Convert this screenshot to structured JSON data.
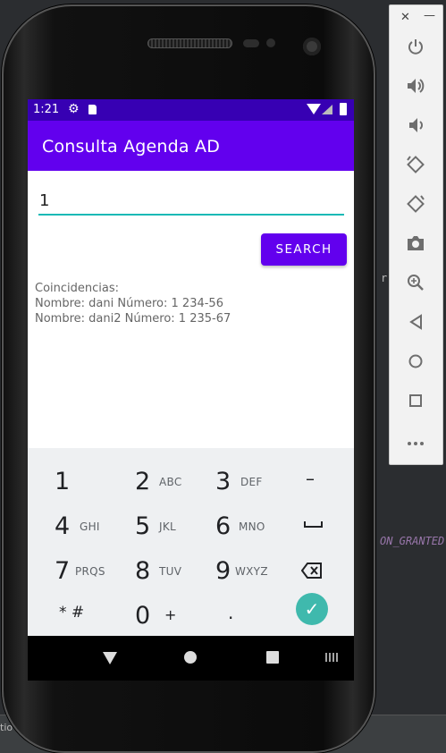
{
  "ide": {
    "code_fragment": "ON_GRANTED",
    "code_char": "r",
    "bottom_fragment": "tio"
  },
  "status_bar": {
    "time": "1:21"
  },
  "app_bar": {
    "title": "Consulta Agenda AD"
  },
  "form": {
    "search_value": "1",
    "search_button": "SEARCH"
  },
  "results": {
    "header": "Coincidencias:",
    "items": [
      "Nombre: dani Número: 1 234-56",
      "Nombre: dani2 Número: 1 235-67"
    ]
  },
  "keypad": {
    "keys": [
      {
        "digit": "1",
        "letters": ""
      },
      {
        "digit": "2",
        "letters": "ABC"
      },
      {
        "digit": "3",
        "letters": "DEF"
      },
      {
        "digit": "4",
        "letters": "GHI"
      },
      {
        "digit": "5",
        "letters": "JKL"
      },
      {
        "digit": "6",
        "letters": "MNO"
      },
      {
        "digit": "7",
        "letters": "PRQS"
      },
      {
        "digit": "8",
        "letters": "TUV"
      },
      {
        "digit": "9",
        "letters": "WXYZ"
      },
      {
        "digit": "0",
        "letters": "+"
      }
    ],
    "dash": "–",
    "star_hash": "* #",
    "period": ".",
    "space_icon": "space-icon",
    "backspace_icon": "backspace-icon",
    "done_icon": "check-icon"
  },
  "colors": {
    "status_bar": "#3700b3",
    "primary": "#6200ee",
    "accent": "#19b9b6",
    "keypad_bg": "#eef0f2",
    "done_key": "#3fb9ad"
  }
}
